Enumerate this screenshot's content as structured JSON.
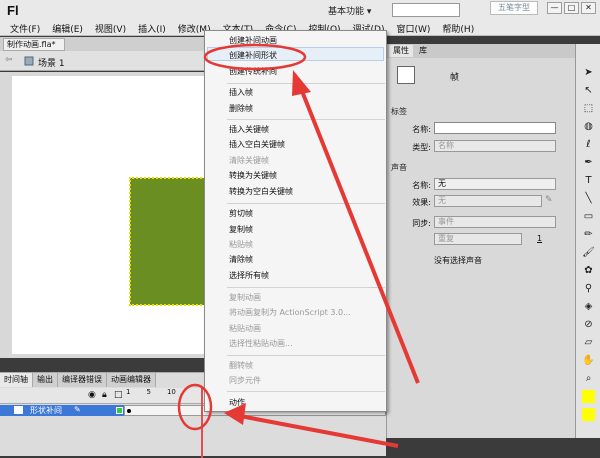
{
  "app": {
    "logo": "Fl",
    "workspace": "基本功能 ▾",
    "search_placeholder": "",
    "watermark": "五笔字型"
  },
  "window_buttons": [
    "—",
    "□",
    "✕"
  ],
  "menus": [
    "文件(F)",
    "编辑(E)",
    "视图(V)",
    "插入(I)",
    "修改(M)",
    "文本(T)",
    "命令(C)",
    "控制(O)",
    "调试(D)",
    "窗口(W)",
    "帮助(H)"
  ],
  "document": {
    "tab": "制作动画.fla*",
    "close": "×",
    "scene": "场景 1"
  },
  "timeline": {
    "tabs": [
      "时间轴",
      "输出",
      "编译器错误",
      "动画编辑器"
    ],
    "ruler": [
      "1",
      "5",
      "10"
    ],
    "layer_name": "形状补间"
  },
  "context_menu": {
    "items": [
      {
        "label": "创建补间动画",
        "disabled": false
      },
      {
        "label": "创建补间形状",
        "disabled": false,
        "highlighted": true
      },
      {
        "label": "创建传统补间",
        "disabled": false
      },
      {
        "label": "插入帧",
        "disabled": false
      },
      {
        "label": "删除帧",
        "disabled": false
      },
      {
        "label": "插入关键帧",
        "disabled": false
      },
      {
        "label": "插入空白关键帧",
        "disabled": false
      },
      {
        "label": "清除关键帧",
        "disabled": true
      },
      {
        "label": "转换为关键帧",
        "disabled": false
      },
      {
        "label": "转换为空白关键帧",
        "disabled": false
      },
      {
        "label": "剪切帧",
        "disabled": false
      },
      {
        "label": "复制帧",
        "disabled": false
      },
      {
        "label": "粘贴帧",
        "disabled": true
      },
      {
        "label": "清除帧",
        "disabled": false
      },
      {
        "label": "选择所有帧",
        "disabled": false
      },
      {
        "label": "复制动画",
        "disabled": true
      },
      {
        "label": "将动画复制为 ActionScript 3.0...",
        "disabled": true
      },
      {
        "label": "粘贴动画",
        "disabled": true
      },
      {
        "label": "选择性粘贴动画...",
        "disabled": true
      },
      {
        "label": "翻转帧",
        "disabled": true
      },
      {
        "label": "同步元件",
        "disabled": true
      },
      {
        "label": "动作",
        "disabled": false
      }
    ]
  },
  "properties": {
    "tabs": [
      "属性",
      "库"
    ],
    "frame_label": "帧",
    "label_section": "标签",
    "name_label": "名称:",
    "name_value": "",
    "type_label": "类型:",
    "type_value": "名称",
    "sound_section": "声音",
    "sound_name_label": "名称:",
    "sound_name_value": "无",
    "effect_label": "效果:",
    "effect_value": "无",
    "sync_label": "同步:",
    "sync_value": "事件",
    "repeat_value": "重复",
    "repeat_count": "1",
    "no_sound": "没有选择声音"
  },
  "colors": {
    "accent": "#e53935",
    "shape_fill": "#6b8e23",
    "layer_selected": "#3c78d8"
  }
}
